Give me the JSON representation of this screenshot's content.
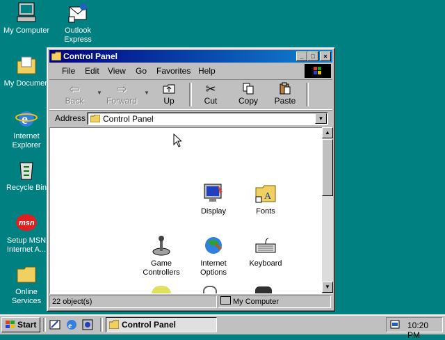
{
  "desktop": {
    "icons": [
      {
        "label": "My Computer"
      },
      {
        "label": "Outlook Express"
      },
      {
        "label": "My Documen"
      },
      {
        "label": "Internet Explorer"
      },
      {
        "label": "Recycle Bin"
      },
      {
        "label": "Setup MSN Internet A..."
      },
      {
        "label": "Online Services"
      }
    ]
  },
  "window": {
    "title": "Control Panel",
    "menu": [
      "File",
      "Edit",
      "View",
      "Go",
      "Favorites",
      "Help"
    ],
    "toolbar": {
      "back": "Back",
      "forward": "Forward",
      "up": "Up",
      "cut": "Cut",
      "copy": "Copy",
      "paste": "Paste"
    },
    "address_label": "Address",
    "address_value": "Control Panel",
    "items": [
      {
        "label": "Display",
        "icon": "display-icon"
      },
      {
        "label": "Fonts",
        "icon": "fonts-folder-icon"
      },
      {
        "label": "Game Controllers",
        "icon": "joystick-icon"
      },
      {
        "label": "Internet Options",
        "icon": "internet-options-icon"
      },
      {
        "label": "Keyboard",
        "icon": "keyboard-icon"
      }
    ],
    "status": {
      "count": "22 object(s)",
      "zone": "My Computer"
    }
  },
  "taskbar": {
    "start": "Start",
    "task": "Control Panel",
    "clock": "10:20 PM"
  }
}
